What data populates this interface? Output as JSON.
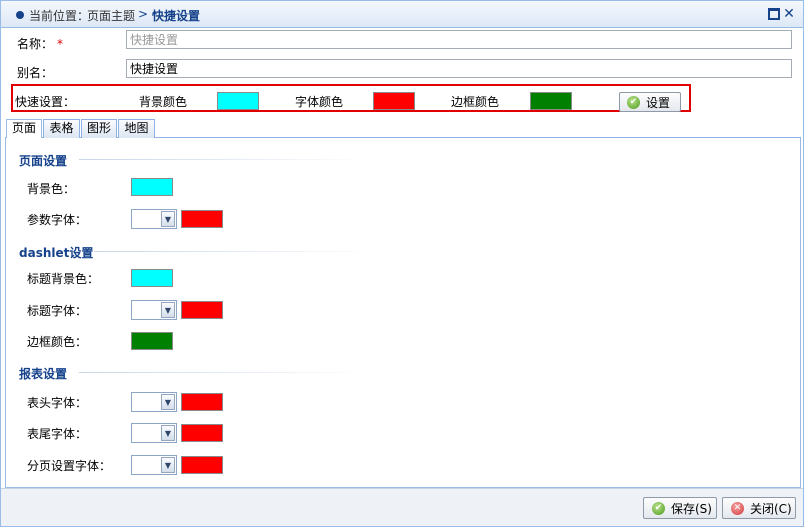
{
  "breadcrumb": {
    "root": "当前位置：",
    "page": "页面主题",
    "separator": ">",
    "current": "快捷设置"
  },
  "window_controls": {
    "maximize_icon": "maximize-icon",
    "close_icon": "close-icon",
    "close_glyph": "✕"
  },
  "form": {
    "name_label": "名称：",
    "required_mark": "*",
    "name_placeholder": "快捷设置",
    "alias_label": "别名：",
    "alias_value": "快捷设置"
  },
  "quick": {
    "label": "快速设置：",
    "bg_label": "背景颜色",
    "font_label": "字体颜色",
    "border_label": "边框颜色",
    "bg_color": "#00ffff",
    "font_color": "#ff0000",
    "border_color": "#008000",
    "set_button": "设置"
  },
  "tabs": [
    {
      "label": "页面",
      "active": true
    },
    {
      "label": "表格",
      "active": false
    },
    {
      "label": "图形",
      "active": false
    },
    {
      "label": "地图",
      "active": false
    }
  ],
  "page_settings": {
    "title": "页面设置",
    "bg_label": "背景色：",
    "param_font_label": "参数字体：",
    "bg_color": "#00ffff",
    "param_font_color": "#ff0000"
  },
  "dashlet_settings": {
    "title": "dashlet设置",
    "title_bg_label": "标题背景色：",
    "title_font_label": "标题字体：",
    "border_label": "边框颜色：",
    "title_bg_color": "#00ffff",
    "title_font_color": "#ff0000",
    "border_color": "#008000"
  },
  "report_settings": {
    "title": "报表设置",
    "header_font_label": "表头字体：",
    "footer_font_label": "表尾字体：",
    "paging_font_label": "分页设置字体：",
    "header_font_color": "#ff0000",
    "footer_font_color": "#ff0000",
    "paging_font_color": "#ff0000"
  },
  "footer": {
    "save_button": "保存(S)",
    "close_button": "关闭(C)"
  },
  "colors": {
    "accent": "#15428b",
    "border": "#99bbe8",
    "highlight": "#e00000"
  }
}
